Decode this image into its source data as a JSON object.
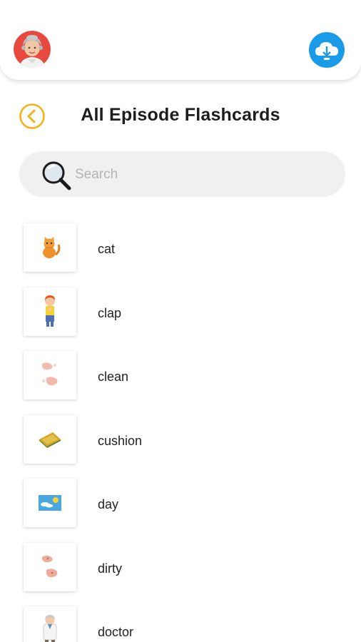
{
  "header": {
    "avatar_icon": "grandma-avatar-icon",
    "download_icon": "cloud-download-icon"
  },
  "page": {
    "title": "All Episode Flashcards",
    "back_icon": "chevron-left-icon"
  },
  "search": {
    "placeholder": "Search",
    "value": "",
    "icon": "magnifier-icon"
  },
  "flashcards": [
    {
      "word": "cat",
      "image": "cat-image"
    },
    {
      "word": "clap",
      "image": "boy-clapping-image"
    },
    {
      "word": "clean",
      "image": "hands-cleaning-image"
    },
    {
      "word": "cushion",
      "image": "cushion-image"
    },
    {
      "word": "day",
      "image": "sunny-sky-image"
    },
    {
      "word": "dirty",
      "image": "dirty-hands-image"
    },
    {
      "word": "doctor",
      "image": "doctor-image"
    }
  ],
  "colors": {
    "accent": "#f3b21b",
    "download": "#1a9be8",
    "search_bg": "#f0f0f0"
  }
}
